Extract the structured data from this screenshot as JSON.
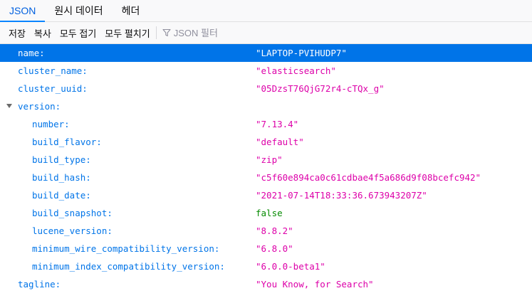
{
  "tabs": [
    {
      "label": "JSON",
      "active": true
    },
    {
      "label": "원시 데이터",
      "active": false
    },
    {
      "label": "헤더",
      "active": false
    }
  ],
  "toolbar": {
    "save": "저장",
    "copy": "복사",
    "collapse_all": "모두 접기",
    "expand_all": "모두 펼치기",
    "filter_placeholder": "JSON 필터",
    "filter_icon": "funnel-icon"
  },
  "colors": {
    "key": "#0074e8",
    "string": "#dd00a9",
    "boolean": "#058b00",
    "selected_row": "#0074e8"
  },
  "json": {
    "name": {
      "key": "name:",
      "value": "\"LAPTOP-PVIHUDP7\""
    },
    "cluster_name": {
      "key": "cluster_name:",
      "value": "\"elasticsearch\""
    },
    "cluster_uuid": {
      "key": "cluster_uuid:",
      "value": "\"05DzsT76QjG72r4-cTQx_g\""
    },
    "version": {
      "key": "version:",
      "number": {
        "key": "number:",
        "value": "\"7.13.4\""
      },
      "build_flavor": {
        "key": "build_flavor:",
        "value": "\"default\""
      },
      "build_type": {
        "key": "build_type:",
        "value": "\"zip\""
      },
      "build_hash": {
        "key": "build_hash:",
        "value": "\"c5f60e894ca0c61cdbae4f5a686d9f08bcefc942\""
      },
      "build_date": {
        "key": "build_date:",
        "value": "\"2021-07-14T18:33:36.673943207Z\""
      },
      "build_snapshot": {
        "key": "build_snapshot:",
        "value": "false"
      },
      "lucene_version": {
        "key": "lucene_version:",
        "value": "\"8.8.2\""
      },
      "minimum_wire_compatibility_version": {
        "key": "minimum_wire_compatibility_version:",
        "value": "\"6.8.0\""
      },
      "minimum_index_compatibility_version": {
        "key": "minimum_index_compatibility_version:",
        "value": "\"6.0.0-beta1\""
      }
    },
    "tagline": {
      "key": "tagline:",
      "value": "\"You Know, for Search\""
    }
  }
}
